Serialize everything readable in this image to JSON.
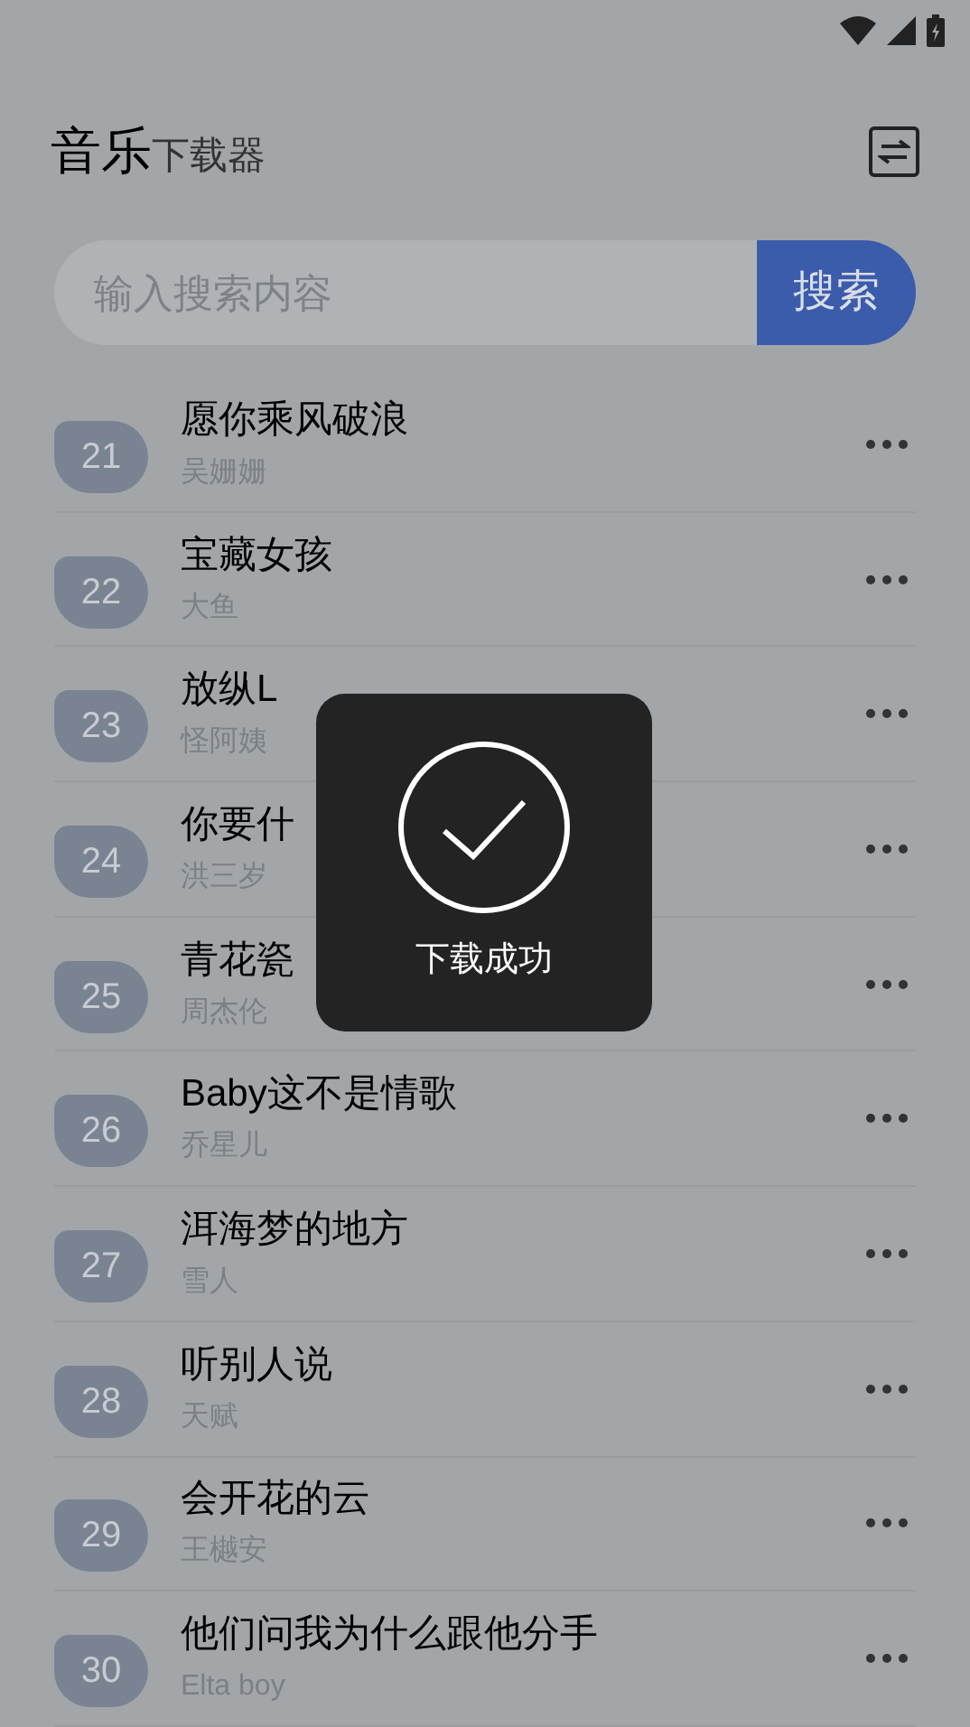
{
  "header": {
    "title": "音乐",
    "subtitle": "下载器"
  },
  "search": {
    "placeholder": "输入搜索内容",
    "button": "搜索"
  },
  "songs": [
    {
      "number": "21",
      "title": "愿你乘风破浪",
      "artist": "吴姗姗"
    },
    {
      "number": "22",
      "title": "宝藏女孩",
      "artist": "大鱼"
    },
    {
      "number": "23",
      "title": "放纵L",
      "artist": "怪阿姨"
    },
    {
      "number": "24",
      "title": "你要什",
      "artist": "洪三岁"
    },
    {
      "number": "25",
      "title": "青花瓷",
      "artist": "周杰伦"
    },
    {
      "number": "26",
      "title": "Baby这不是情歌",
      "artist": "乔星儿"
    },
    {
      "number": "27",
      "title": "洱海梦的地方",
      "artist": "雪人"
    },
    {
      "number": "28",
      "title": "听别人说",
      "artist": "天赋"
    },
    {
      "number": "29",
      "title": "会开花的云",
      "artist": "王樾安"
    },
    {
      "number": "30",
      "title": "他们问我为什么跟他分手",
      "artist": "Elta boy"
    }
  ],
  "toast": {
    "text": "下载成功"
  }
}
